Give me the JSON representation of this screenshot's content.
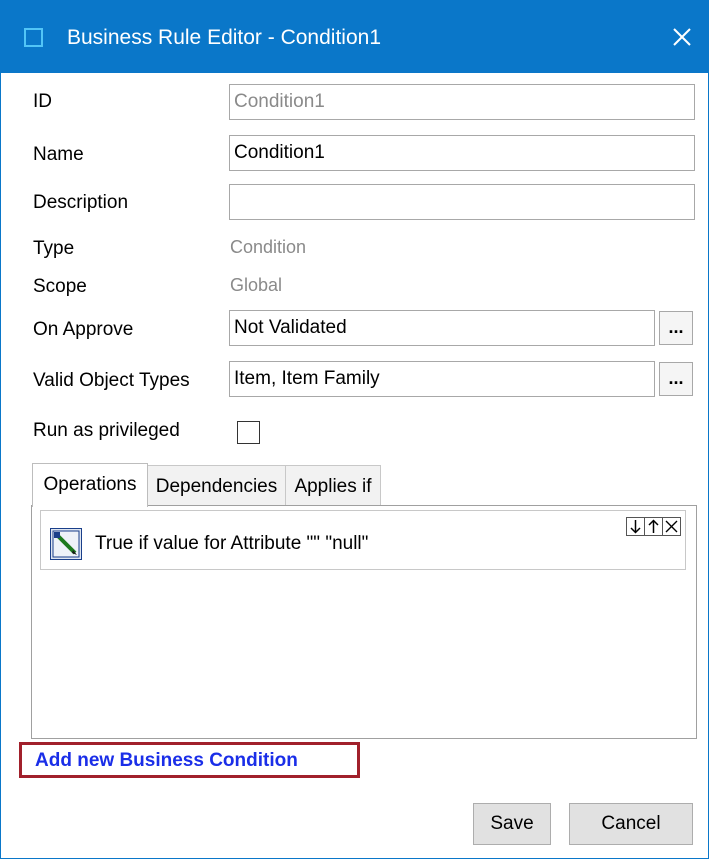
{
  "window": {
    "title": "Business Rule Editor - Condition1"
  },
  "form": {
    "id_label": "ID",
    "id_value": "Condition1",
    "name_label": "Name",
    "name_value": "Condition1",
    "description_label": "Description",
    "description_value": "",
    "type_label": "Type",
    "type_value": "Condition",
    "scope_label": "Scope",
    "scope_value": "Global",
    "on_approve_label": "On Approve",
    "on_approve_value": "Not Validated",
    "valid_object_types_label": "Valid Object Types",
    "valid_object_types_value": "Item, Item Family",
    "run_as_privileged_label": "Run as privileged",
    "run_as_privileged_checked": false,
    "ellipsis_label": "..."
  },
  "tabs": [
    {
      "label": "Operations",
      "active": true
    },
    {
      "label": "Dependencies",
      "active": false
    },
    {
      "label": "Applies if",
      "active": false
    }
  ],
  "operations": [
    {
      "text": "True if value for Attribute \"\"  \"null\"",
      "icon": "condition-editor-icon"
    }
  ],
  "op_controls": {
    "down": "↓",
    "up": "↑",
    "remove": "✕"
  },
  "add_link_label": "Add new Business Condition",
  "buttons": {
    "save": "Save",
    "cancel": "Cancel"
  },
  "colors": {
    "titlebar": "#0a77c9",
    "link": "#1a2ee8",
    "highlight_border": "#a1202b"
  }
}
